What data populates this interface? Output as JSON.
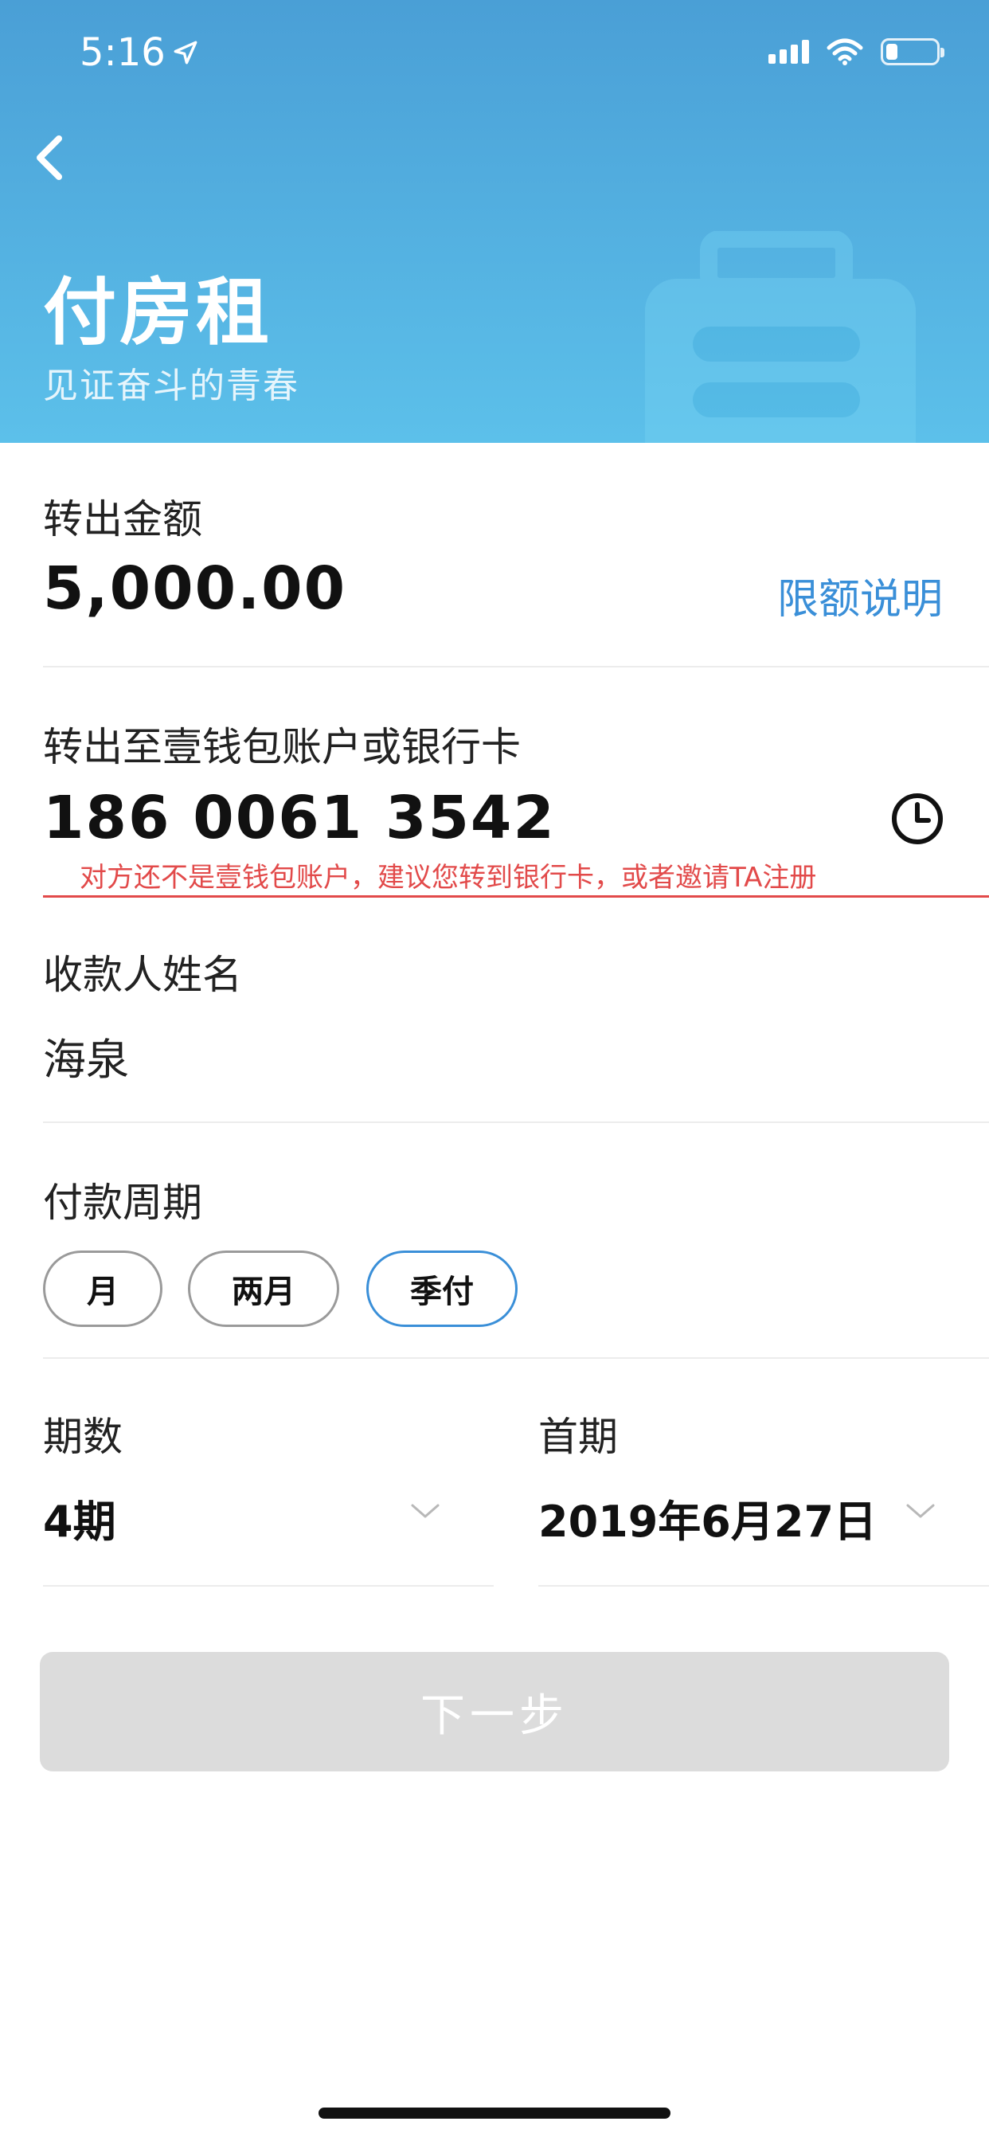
{
  "status_bar": {
    "time": "5:16"
  },
  "header": {
    "title": "付房租",
    "subtitle": "见证奋斗的青春",
    "bg_colors": [
      "#4a9fd6",
      "#5cc0ea"
    ]
  },
  "amount_section": {
    "label": "转出金额",
    "value": "5,000.00",
    "limit_link": "限额说明"
  },
  "recipient_section": {
    "label": "转出至壹钱包账户或银行卡",
    "value": "186 0061 3542",
    "error": "对方还不是壹钱包账户，建议您转到银行卡，或者邀请TA注册",
    "error_color": "#e24a4a"
  },
  "payee_section": {
    "label": "收款人姓名",
    "value": "海泉"
  },
  "period_section": {
    "label": "付款周期",
    "options": [
      "月",
      "两月",
      "季付"
    ],
    "selected": "季付",
    "accent_color": "#3a8fd8"
  },
  "installments": {
    "label": "期数",
    "value": "4期"
  },
  "first_period": {
    "label": "首期",
    "value": "2019年6月27日"
  },
  "next_button": {
    "label": "下一步"
  }
}
